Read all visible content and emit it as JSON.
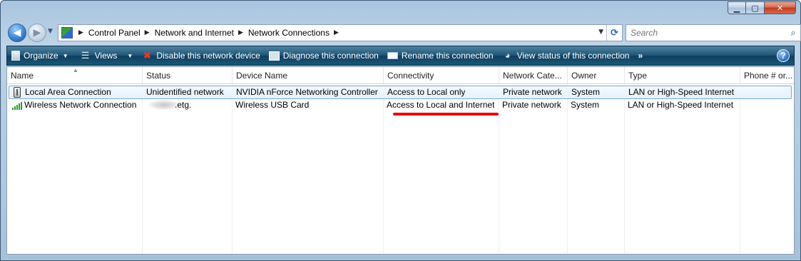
{
  "window": {
    "buttons": {
      "minimize": "▁",
      "maximize": "▢",
      "close": "✕"
    }
  },
  "nav": {
    "back_icon": "back-arrow-icon",
    "forward_icon": "forward-arrow-icon",
    "breadcrumbs": [
      "Control Panel",
      "Network and Internet",
      "Network Connections"
    ],
    "search_placeholder": "Search"
  },
  "toolbar": {
    "organize": "Organize",
    "views": "Views",
    "disable": "Disable this network device",
    "diagnose": "Diagnose this connection",
    "rename": "Rename this connection",
    "view_status": "View status of this connection",
    "more": "»",
    "help": "?"
  },
  "columns": [
    "Name",
    "Status",
    "Device Name",
    "Connectivity",
    "Network Cate...",
    "Owner",
    "Type",
    "Phone # or..."
  ],
  "rows": [
    {
      "icon": "ethernet-icon",
      "name": "Local Area Connection",
      "status": "Unidentified network",
      "device": "NVIDIA nForce Networking Controller",
      "connectivity": "Access to Local only",
      "category": "Private network",
      "owner": "System",
      "type": "LAN or High-Speed Internet",
      "phone": ""
    },
    {
      "icon": "wireless-signal-icon",
      "name": "Wireless Network Connection",
      "status": ".etg.",
      "device": "Wireless USB Card",
      "connectivity": "Access to Local and Internet",
      "category": "Private network",
      "owner": "System",
      "type": "LAN or High-Speed Internet",
      "phone": ""
    }
  ],
  "colors": {
    "toolbar": "#1f5678",
    "selection_border": "#7aa7d4",
    "annotation": "#e80d0d"
  }
}
